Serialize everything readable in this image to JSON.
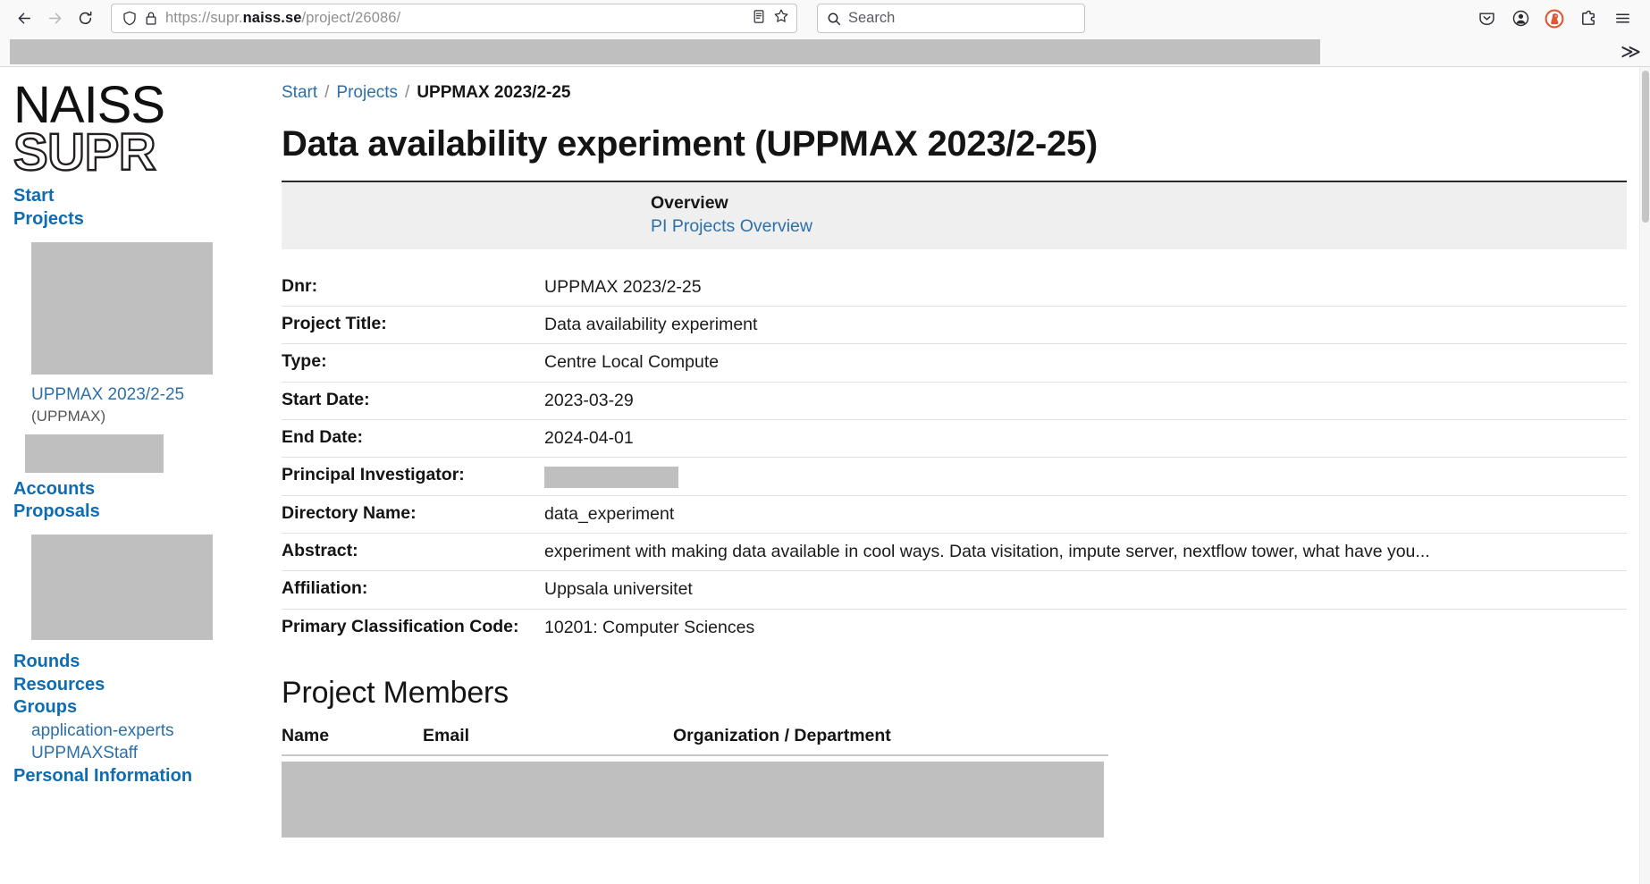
{
  "browser": {
    "back_icon": "back-arrow-icon",
    "forward_icon": "forward-arrow-icon",
    "reload_icon": "reload-icon",
    "url": "https://supr.naiss.se/project/26086/",
    "url_prefix": "https://supr.",
    "url_domain": "naiss.se",
    "url_suffix": "/project/26086/",
    "shield_icon": "tracking-protection-shield-icon",
    "lock_icon": "padlock-icon",
    "reader_icon": "reader-view-icon",
    "bookmark_icon": "bookmark-star-icon",
    "search_placeholder": "Search",
    "search_icon": "magnifier-icon",
    "pocket_icon": "pocket-save-icon",
    "account_icon": "account-avatar-icon",
    "duckduckgo_icon": "duckduckgo-extension-icon",
    "extensions_icon": "extensions-puzzle-icon",
    "menu_icon": "hamburger-menu-icon",
    "bookmarks_overflow": "≫",
    "accent_blue": "#0060df",
    "duckduckgo_orange": "#de5833"
  },
  "sidebar": {
    "logo_line1": "NAISS",
    "logo_line2": "SUPR",
    "items": [
      {
        "label": "Start",
        "kind": "top"
      },
      {
        "label": "Projects",
        "kind": "top"
      }
    ],
    "project_link": "UPPMAX 2023/2-25",
    "project_centre": "(UPPMAX)",
    "items2": [
      {
        "label": "Accounts",
        "kind": "top"
      },
      {
        "label": "Proposals",
        "kind": "top"
      }
    ],
    "items3": [
      {
        "label": "Rounds",
        "kind": "top"
      },
      {
        "label": "Resources",
        "kind": "top"
      },
      {
        "label": "Groups",
        "kind": "top"
      }
    ],
    "groups": [
      {
        "label": "application-experts"
      },
      {
        "label": "UPPMAXStaff"
      }
    ],
    "truncated_item": "Personal Information",
    "link_color": "#0f6cb1"
  },
  "breadcrumb": {
    "start": "Start",
    "projects": "Projects",
    "current": "UPPMAX 2023/2-25",
    "separator": "/"
  },
  "main": {
    "page_title": "Data availability experiment (UPPMAX 2023/2-25)",
    "overview": {
      "heading": "Overview",
      "link": "PI Projects Overview"
    },
    "info_rows": [
      {
        "label": "Dnr:",
        "value": "UPPMAX 2023/2-25",
        "redacted": false
      },
      {
        "label": "Project Title:",
        "value": "Data availability experiment",
        "redacted": false
      },
      {
        "label": "Type:",
        "value": "Centre Local Compute",
        "redacted": false
      },
      {
        "label": "Start Date:",
        "value": "2023-03-29",
        "redacted": false
      },
      {
        "label": "End Date:",
        "value": "2024-04-01",
        "redacted": false
      },
      {
        "label": "Principal Investigator:",
        "value": "",
        "redacted": true
      },
      {
        "label": "Directory Name:",
        "value": "data_experiment",
        "redacted": false
      },
      {
        "label": "Abstract:",
        "value": "experiment with making data available in cool ways. Data visitation, impute server, nextflow tower, what have you...",
        "redacted": false
      },
      {
        "label": "Affiliation:",
        "value": "Uppsala universitet",
        "redacted": false
      },
      {
        "label": "Primary Classification Code:",
        "value": "10201: Computer Sciences",
        "redacted": false
      }
    ],
    "members": {
      "title": "Project Members",
      "columns": [
        "Name",
        "Email",
        "Organization / Department"
      ],
      "rows_redacted": true
    }
  }
}
